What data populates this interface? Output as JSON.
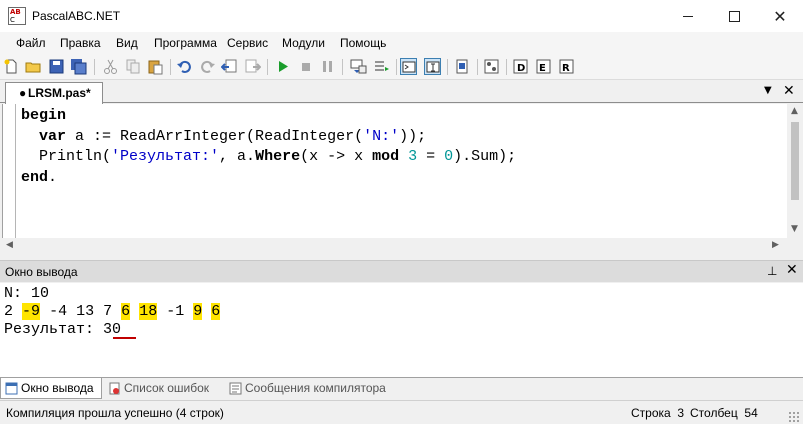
{
  "window": {
    "title": "PascalABC.NET",
    "icon_text_top": "AB",
    "icon_text_bottom": "C"
  },
  "menu": [
    "Файл",
    "Правка",
    "Вид",
    "Программа",
    "Сервис",
    "Модули",
    "Помощь"
  ],
  "toolbar": {
    "icons": [
      "new-file-icon",
      "open-folder-icon",
      "save-icon",
      "save-all-icon",
      "cut-icon",
      "copy-icon",
      "paste-icon",
      "undo-icon",
      "redo-icon",
      "navigate-back-icon",
      "navigate-forward-icon",
      "run-icon",
      "stop-icon",
      "step-into-icon",
      "step-over-icon",
      "output-window-toggle-icon",
      "input-window-toggle-icon",
      "debug-window-icon",
      "watch-icon",
      "form-designer-icon",
      "compile-icon",
      "run-no-debug-icon"
    ]
  },
  "editor": {
    "tab_label": "LRSM.pas*",
    "tab_mark": "●",
    "lines": [
      [
        {
          "t": "begin",
          "c": "kw"
        }
      ],
      [
        {
          "t": "  ",
          "c": "plain"
        },
        {
          "t": "var",
          "c": "kw"
        },
        {
          "t": " a := ReadArrInteger(ReadInteger(",
          "c": "plain"
        },
        {
          "t": "'N:'",
          "c": "str"
        },
        {
          "t": "));",
          "c": "plain"
        }
      ],
      [
        {
          "t": "  Println(",
          "c": "plain"
        },
        {
          "t": "'Результат:'",
          "c": "str"
        },
        {
          "t": ", a.",
          "c": "plain"
        },
        {
          "t": "Where",
          "c": "kw"
        },
        {
          "t": "(x -> x ",
          "c": "plain"
        },
        {
          "t": "mod",
          "c": "kw"
        },
        {
          "t": " ",
          "c": "plain"
        },
        {
          "t": "3",
          "c": "num"
        },
        {
          "t": " = ",
          "c": "plain"
        },
        {
          "t": "0",
          "c": "num"
        },
        {
          "t": ").Sum);",
          "c": "plain"
        }
      ],
      [
        {
          "t": "end",
          "c": "kw"
        },
        {
          "t": ".",
          "c": "plain"
        }
      ]
    ]
  },
  "output": {
    "title": "Окно вывода",
    "line1": "N: 10",
    "tokens": [
      {
        "t": "2",
        "hl": false
      },
      {
        "t": "-9",
        "hl": true
      },
      {
        "t": "-4",
        "hl": false
      },
      {
        "t": "13",
        "hl": false
      },
      {
        "t": "7",
        "hl": false
      },
      {
        "t": "6",
        "hl": true
      },
      {
        "t": "18",
        "hl": true
      },
      {
        "t": "-1",
        "hl": false
      },
      {
        "t": "9",
        "hl": true
      },
      {
        "t": "6",
        "hl": true
      }
    ],
    "result_label": "Результат: ",
    "result_value": "30",
    "highlight_color": "#ffe400",
    "underline_color": "#c00000"
  },
  "bottom_tabs": [
    {
      "label": "Окно вывода",
      "active": true
    },
    {
      "label": "Список ошибок",
      "active": false
    },
    {
      "label": "Сообщения компилятора",
      "active": false
    }
  ],
  "status": {
    "message": "Компиляция прошла успешно (4 строк)",
    "row_label": "Строка",
    "row_value": "3",
    "col_label": "Столбец",
    "col_value": "54"
  }
}
